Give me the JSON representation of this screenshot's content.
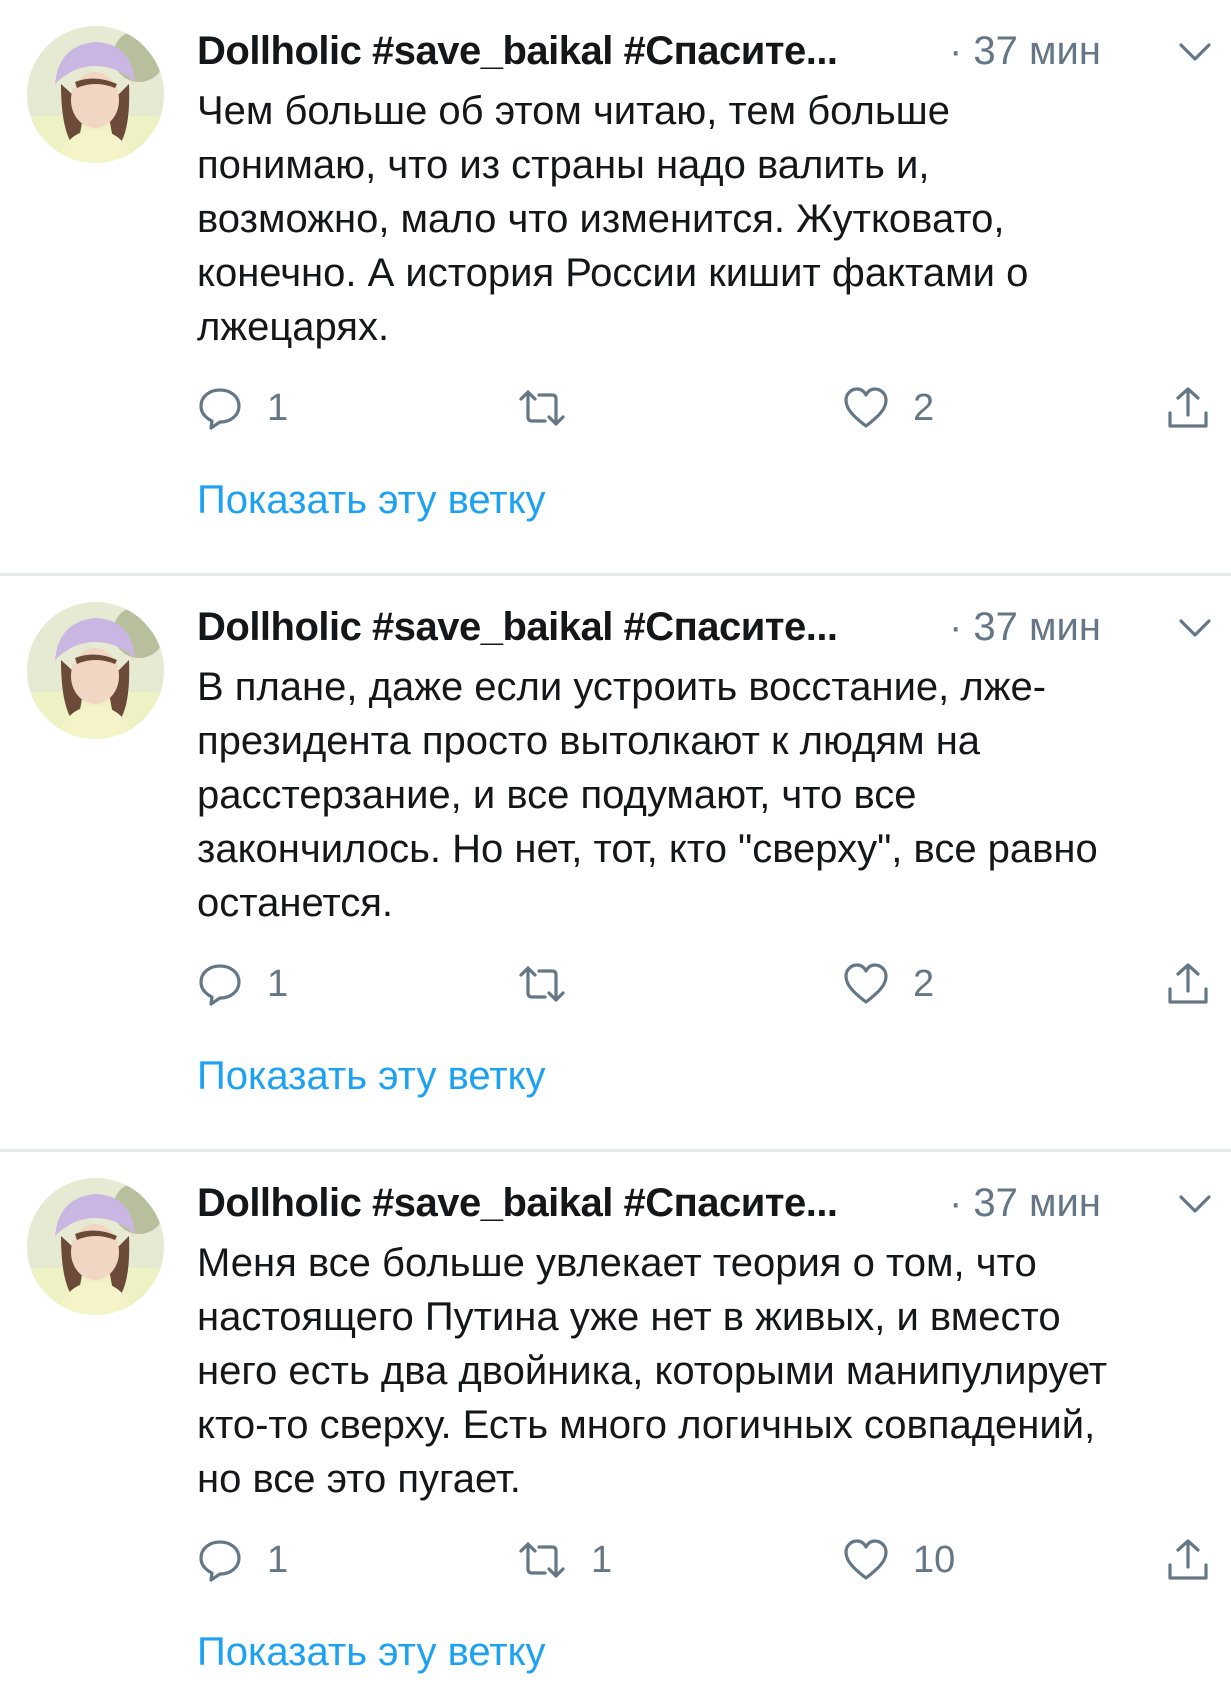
{
  "accent_color": "#1da1f2",
  "muted_color": "#657786",
  "tweets": [
    {
      "author": "Dollholic #save_baikal #Спасите...",
      "time": "· 37 мин",
      "text": "Чем больше об этом читаю, тем больше\nпонимаю, что из страны надо валить и,\nвозможно, мало что изменится. Жутковато,\nконечно. А история России кишит фактами о\nлжецарях.",
      "replies": "1",
      "retweets": "",
      "likes": "2",
      "show_thread": "Показать эту ветку"
    },
    {
      "author": "Dollholic #save_baikal #Спасите...",
      "time": "· 37 мин",
      "text": "В плане, даже если устроить восстание, лже-\nпрезидента просто вытолкают к людям на\nрасстерзание, и все подумают, что все\nзакончилось. Но нет, тот, кто \"сверху\", все равно\nостанется.",
      "replies": "1",
      "retweets": "",
      "likes": "2",
      "show_thread": "Показать эту ветку"
    },
    {
      "author": "Dollholic #save_baikal #Спасите...",
      "time": "· 37 мин",
      "text": "Меня все больше увлекает теория о том, что\nнастоящего Путина уже нет в живых, и вместо\nнего есть два двойника, которыми манипулирует\nкто-то сверху. Есть много логичных совпадений,\nно все это пугает.",
      "replies": "1",
      "retweets": "1",
      "likes": "10",
      "show_thread": "Показать эту ветку"
    }
  ]
}
